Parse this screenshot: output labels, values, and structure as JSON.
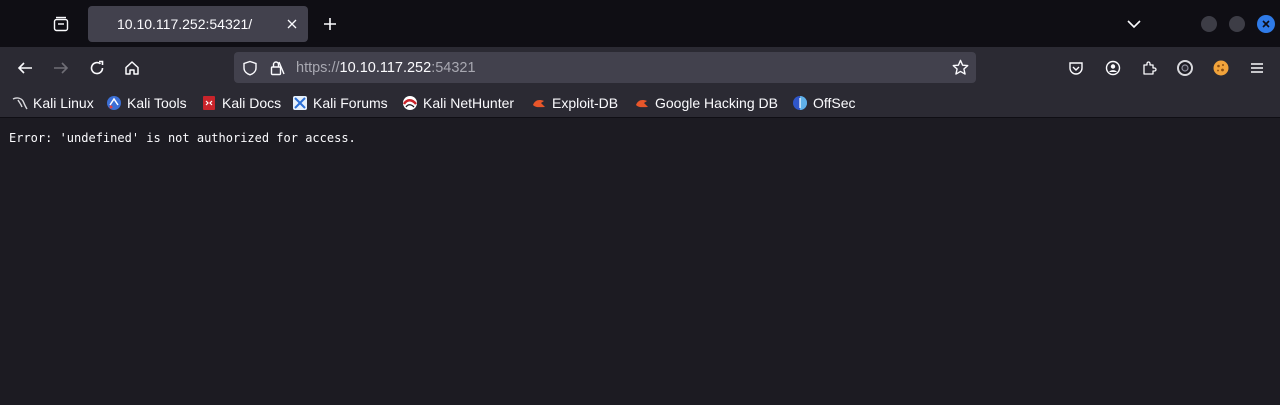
{
  "tab": {
    "title": "10.10.117.252:54321/"
  },
  "urlbar": {
    "scheme": "https://",
    "host": "10.10.117.252",
    "port": ":54321"
  },
  "bookmarks": [
    {
      "label": "Kali Linux",
      "icon": "kali-dragon-icon"
    },
    {
      "label": "Kali Tools",
      "icon": "kali-tools-icon"
    },
    {
      "label": "Kali Docs",
      "icon": "kali-docs-icon"
    },
    {
      "label": "Kali Forums",
      "icon": "kali-forums-icon"
    },
    {
      "label": "Kali NetHunter",
      "icon": "kali-nethunter-icon"
    },
    {
      "label": "Exploit-DB",
      "icon": "exploit-db-icon"
    },
    {
      "label": "Google Hacking DB",
      "icon": "google-hacking-db-icon"
    },
    {
      "label": "OffSec",
      "icon": "offsec-icon"
    }
  ],
  "content": {
    "text": "Error: 'undefined' is not authorized for access."
  },
  "colors": {
    "tabstrip_bg": "#0f0e14",
    "toolbar_bg": "#2b2a33",
    "urlbar_bg": "#42414d",
    "content_bg": "#1c1b22",
    "text": "#fbfbfe",
    "close_accent": "#2f7be8"
  }
}
